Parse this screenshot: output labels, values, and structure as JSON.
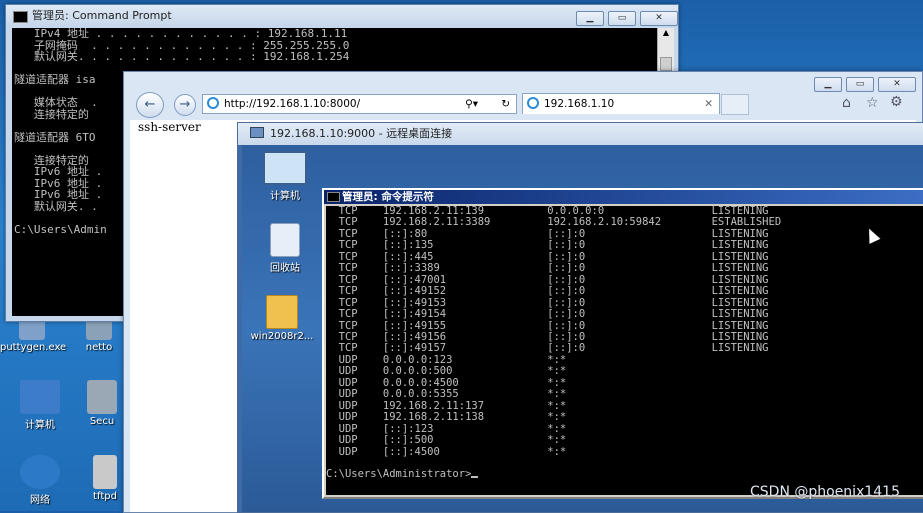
{
  "desktop": {
    "icons": [
      {
        "label": "puttygen.exe",
        "color": "#7fa0c8"
      },
      {
        "label": "netto",
        "color": "#8aa1b8"
      },
      {
        "label": "计算机",
        "color": "#3d7cc9"
      },
      {
        "label": "Secu",
        "color": "#9aa7b5"
      },
      {
        "label": "网络",
        "color": "#2c7ac7"
      },
      {
        "label": "tftpd",
        "color": "#c9c9c9"
      }
    ]
  },
  "local_cmd": {
    "title": "管理员: Command Prompt",
    "lines": [
      "   IPv4 地址 . . . . . . . . . . . . : 192.168.1.11",
      "   子网掩码  . . . . . . . . . . . . : 255.255.255.0",
      "   默认网关. . . . . . . . . . . . . : 192.168.1.254",
      "",
      "隧道适配器 isa",
      "",
      "   媒体状态  .",
      "   连接特定的",
      "",
      "隧道适配器 6TO",
      "",
      "   连接特定的",
      "   IPv6 地址 .",
      "   IPv6 地址 .",
      "   IPv6 地址 .",
      "   默认网关. .",
      "",
      "C:\\Users\\Admin"
    ]
  },
  "browser": {
    "address": "http://192.168.1.10:8000/",
    "tab_title": "192.168.1.10",
    "page_text": "ssh-server"
  },
  "rdp": {
    "title": "192.168.1.10:9000 - 远程桌面连接",
    "icons": [
      {
        "label": "计算机"
      },
      {
        "label": "回收站"
      },
      {
        "label": "win2008r2..."
      }
    ]
  },
  "remote_cmd": {
    "title": "管理员: 命令提示符",
    "rows": [
      [
        "TCP",
        "192.168.2.11:139",
        "0.0.0.0:0",
        "LISTENING"
      ],
      [
        "TCP",
        "192.168.2.11:3389",
        "192.168.2.10:59842",
        "ESTABLISHED"
      ],
      [
        "TCP",
        "[::]:80",
        "[::]:0",
        "LISTENING"
      ],
      [
        "TCP",
        "[::]:135",
        "[::]:0",
        "LISTENING"
      ],
      [
        "TCP",
        "[::]:445",
        "[::]:0",
        "LISTENING"
      ],
      [
        "TCP",
        "[::]:3389",
        "[::]:0",
        "LISTENING"
      ],
      [
        "TCP",
        "[::]:47001",
        "[::]:0",
        "LISTENING"
      ],
      [
        "TCP",
        "[::]:49152",
        "[::]:0",
        "LISTENING"
      ],
      [
        "TCP",
        "[::]:49153",
        "[::]:0",
        "LISTENING"
      ],
      [
        "TCP",
        "[::]:49154",
        "[::]:0",
        "LISTENING"
      ],
      [
        "TCP",
        "[::]:49155",
        "[::]:0",
        "LISTENING"
      ],
      [
        "TCP",
        "[::]:49156",
        "[::]:0",
        "LISTENING"
      ],
      [
        "TCP",
        "[::]:49157",
        "[::]:0",
        "LISTENING"
      ],
      [
        "UDP",
        "0.0.0.0:123",
        "*:*",
        ""
      ],
      [
        "UDP",
        "0.0.0.0:500",
        "*:*",
        ""
      ],
      [
        "UDP",
        "0.0.0.0:4500",
        "*:*",
        ""
      ],
      [
        "UDP",
        "0.0.0.0:5355",
        "*:*",
        ""
      ],
      [
        "UDP",
        "192.168.2.11:137",
        "*:*",
        ""
      ],
      [
        "UDP",
        "192.168.2.11:138",
        "*:*",
        ""
      ],
      [
        "UDP",
        "[::]:123",
        "*:*",
        ""
      ],
      [
        "UDP",
        "[::]:500",
        "*:*",
        ""
      ],
      [
        "UDP",
        "[::]:4500",
        "*:*",
        ""
      ]
    ],
    "prompt": "C:\\Users\\Administrator>"
  },
  "watermark": "CSDN @phoenix1415"
}
